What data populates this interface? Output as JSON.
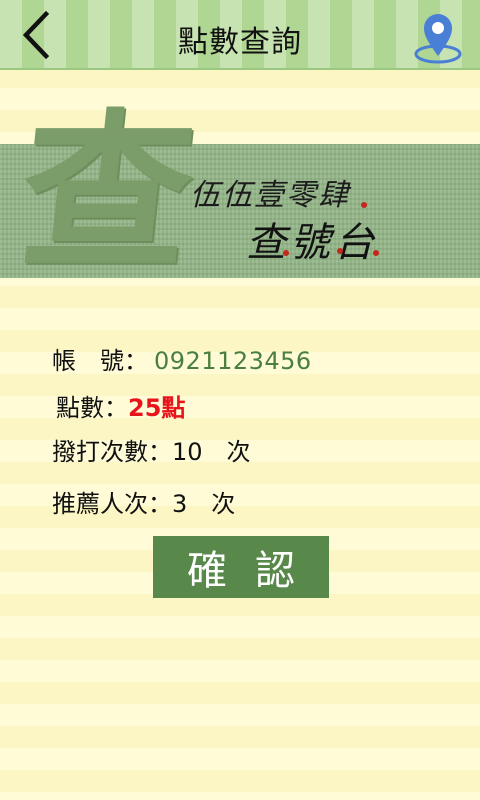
{
  "header": {
    "title": "點數查詢"
  },
  "banner": {
    "big_char": "查",
    "line1": "伍伍壹零肆",
    "line2": "查號台"
  },
  "info": {
    "account_label": "帳　號：",
    "account_value": "0921123456",
    "points_label": "點數：",
    "points_value": "25點",
    "calls_label": "撥打次數：",
    "calls_value": "10　次",
    "referrals_label": "推薦人次：",
    "referrals_value": "3　次"
  },
  "confirm_label": "確認",
  "colors": {
    "header_green": "#b0d694",
    "banner_green": "#92b486",
    "accent_green": "#58894a",
    "points_red": "#e8141c",
    "map_pin_blue": "#4a7fd6"
  },
  "icons": {
    "back": "chevron-left-icon",
    "map": "map-pin-icon"
  }
}
